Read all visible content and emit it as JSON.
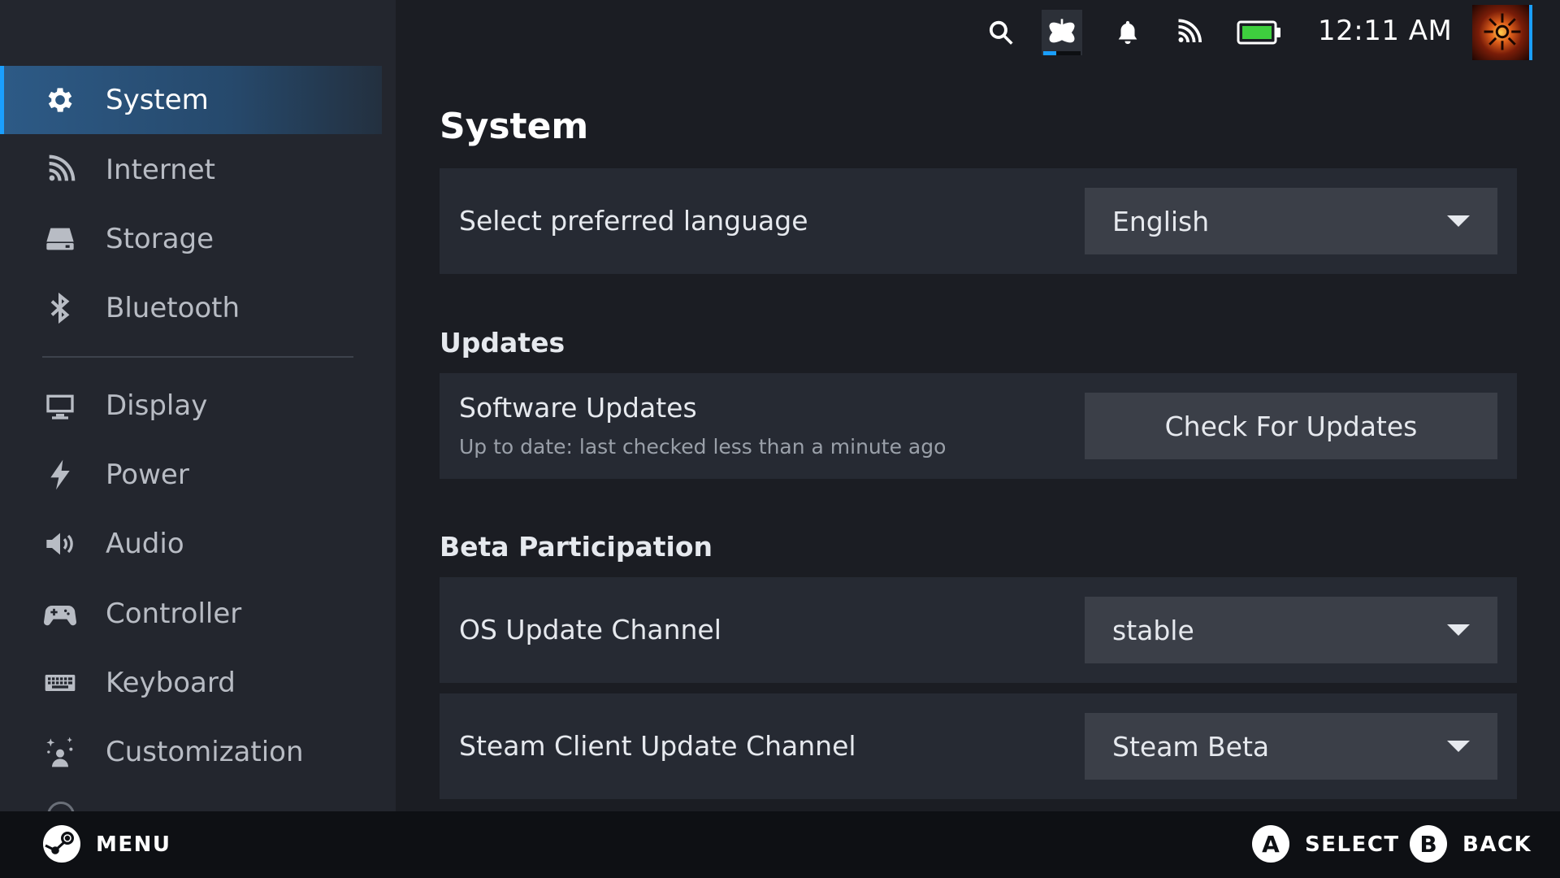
{
  "status_bar": {
    "icons": [
      "search-icon",
      "decky-plugin-icon",
      "bell-icon",
      "wifi-icon",
      "battery-icon"
    ],
    "time": "12:11 AM",
    "battery_color": "#3ecf3e",
    "accent_color": "#1a9fff"
  },
  "sidebar": {
    "items": [
      {
        "label": "System",
        "icon": "gear-icon",
        "active": true
      },
      {
        "label": "Internet",
        "icon": "wifi-icon"
      },
      {
        "label": "Storage",
        "icon": "drive-icon"
      },
      {
        "label": "Bluetooth",
        "icon": "bluetooth-icon"
      },
      {
        "label": "Display",
        "icon": "monitor-icon"
      },
      {
        "label": "Power",
        "icon": "lightning-icon"
      },
      {
        "label": "Audio",
        "icon": "speaker-icon"
      },
      {
        "label": "Controller",
        "icon": "gamepad-icon"
      },
      {
        "label": "Keyboard",
        "icon": "keyboard-icon"
      },
      {
        "label": "Customization",
        "icon": "sparkle-person-icon"
      }
    ]
  },
  "main": {
    "title": "System",
    "language": {
      "label": "Select preferred language",
      "value": "English"
    },
    "updates": {
      "section": "Updates",
      "label": "Software Updates",
      "status": "Up to date: last checked less than a minute ago",
      "button": "Check For Updates"
    },
    "beta": {
      "section": "Beta Participation",
      "os_label": "OS Update Channel",
      "os_value": "stable",
      "client_label": "Steam Client Update Channel",
      "client_value": "Steam Beta"
    }
  },
  "bottom_bar": {
    "menu": "MENU",
    "select_key": "A",
    "select": "SELECT",
    "back_key": "B",
    "back": "BACK"
  }
}
